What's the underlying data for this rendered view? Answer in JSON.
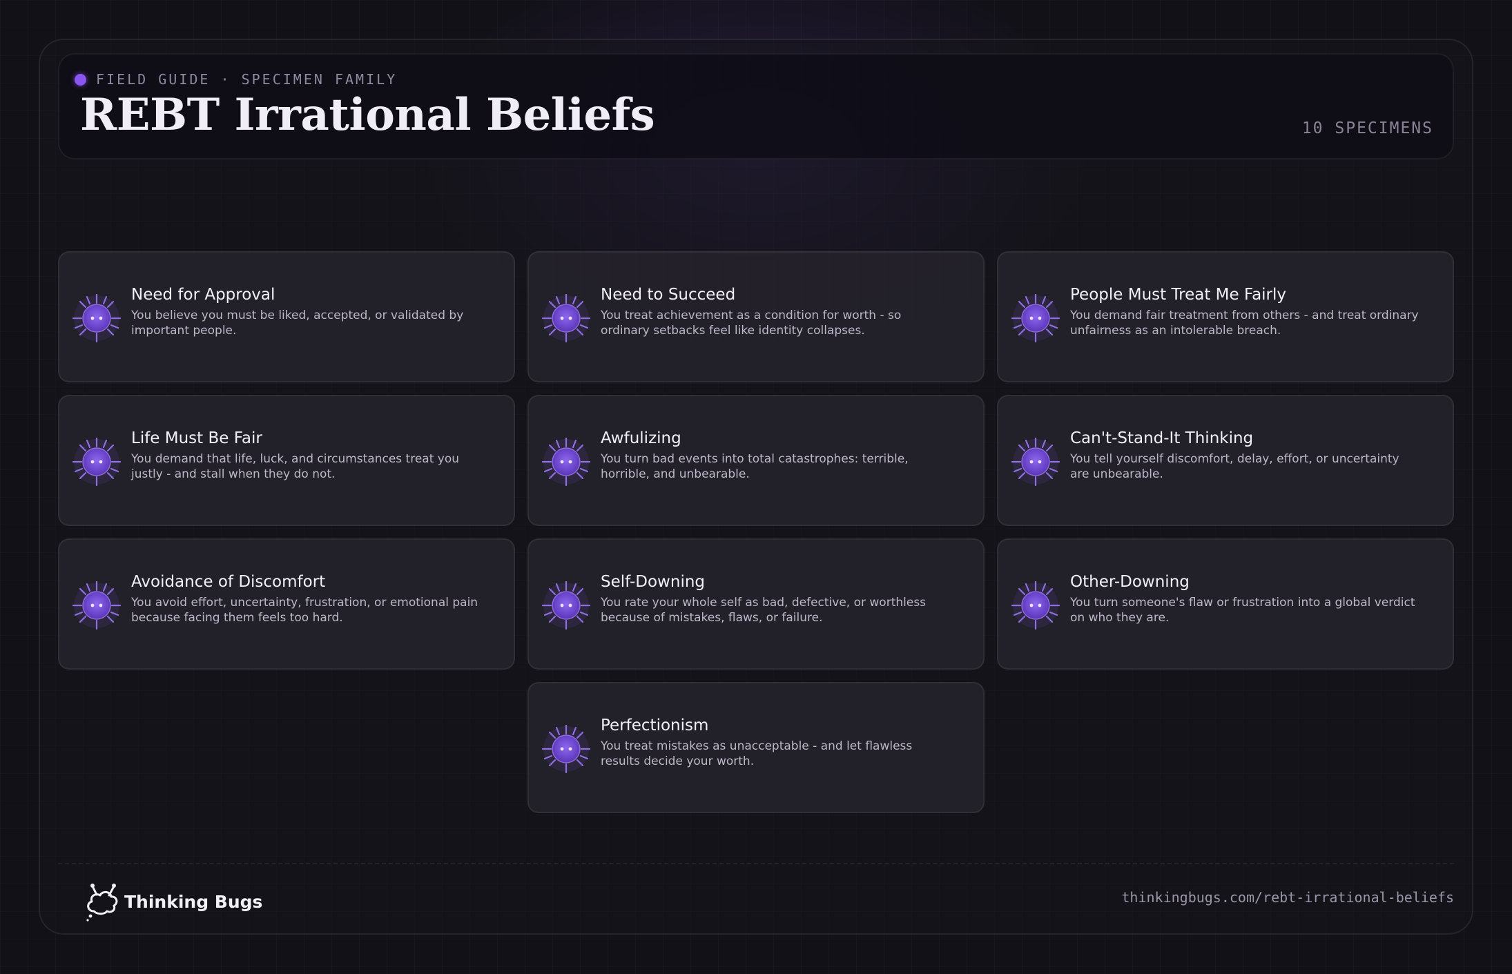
{
  "header": {
    "eyebrow": "FIELD GUIDE · SPECIMEN FAMILY",
    "title": "REBT Irrational Beliefs",
    "count": "10 SPECIMENS"
  },
  "colors": {
    "accent": "#8a55f0",
    "bug": "#7b4fdc"
  },
  "cards": [
    {
      "name": "Need for Approval",
      "desc": "You believe you must be liked, accepted, or validated by important people.",
      "icon": "bug-icon"
    },
    {
      "name": "Need to Succeed",
      "desc": "You treat achievement as a condition for worth - so ordinary setbacks feel like identity collapses.",
      "icon": "bug-icon"
    },
    {
      "name": "People Must Treat Me Fairly",
      "desc": "You demand fair treatment from others - and treat ordinary unfairness as an intolerable breach.",
      "icon": "bug-icon"
    },
    {
      "name": "Life Must Be Fair",
      "desc": "You demand that life, luck, and circumstances treat you justly - and stall when they do not.",
      "icon": "bug-icon"
    },
    {
      "name": "Awfulizing",
      "desc": "You turn bad events into total catastrophes: terrible, horrible, and unbearable.",
      "icon": "bug-icon"
    },
    {
      "name": "Can't-Stand-It Thinking",
      "desc": "You tell yourself discomfort, delay, effort, or uncertainty are unbearable.",
      "icon": "bug-icon"
    },
    {
      "name": "Avoidance of Discomfort",
      "desc": "You avoid effort, uncertainty, frustration, or emotional pain because facing them feels too hard.",
      "icon": "bug-icon"
    },
    {
      "name": "Self-Downing",
      "desc": "You rate your whole self as bad, defective, or worthless because of mistakes, flaws, or failure.",
      "icon": "bug-icon"
    },
    {
      "name": "Other-Downing",
      "desc": "You turn someone's flaw or frustration into a global verdict on who they are.",
      "icon": "bug-icon"
    },
    {
      "name": "Perfectionism",
      "desc": "You treat mistakes as unacceptable - and let flawless results decide your worth.",
      "icon": "bug-icon"
    }
  ],
  "footer": {
    "brand": "Thinking Bugs",
    "url": "thinkingbugs.com/rebt-irrational-beliefs"
  }
}
